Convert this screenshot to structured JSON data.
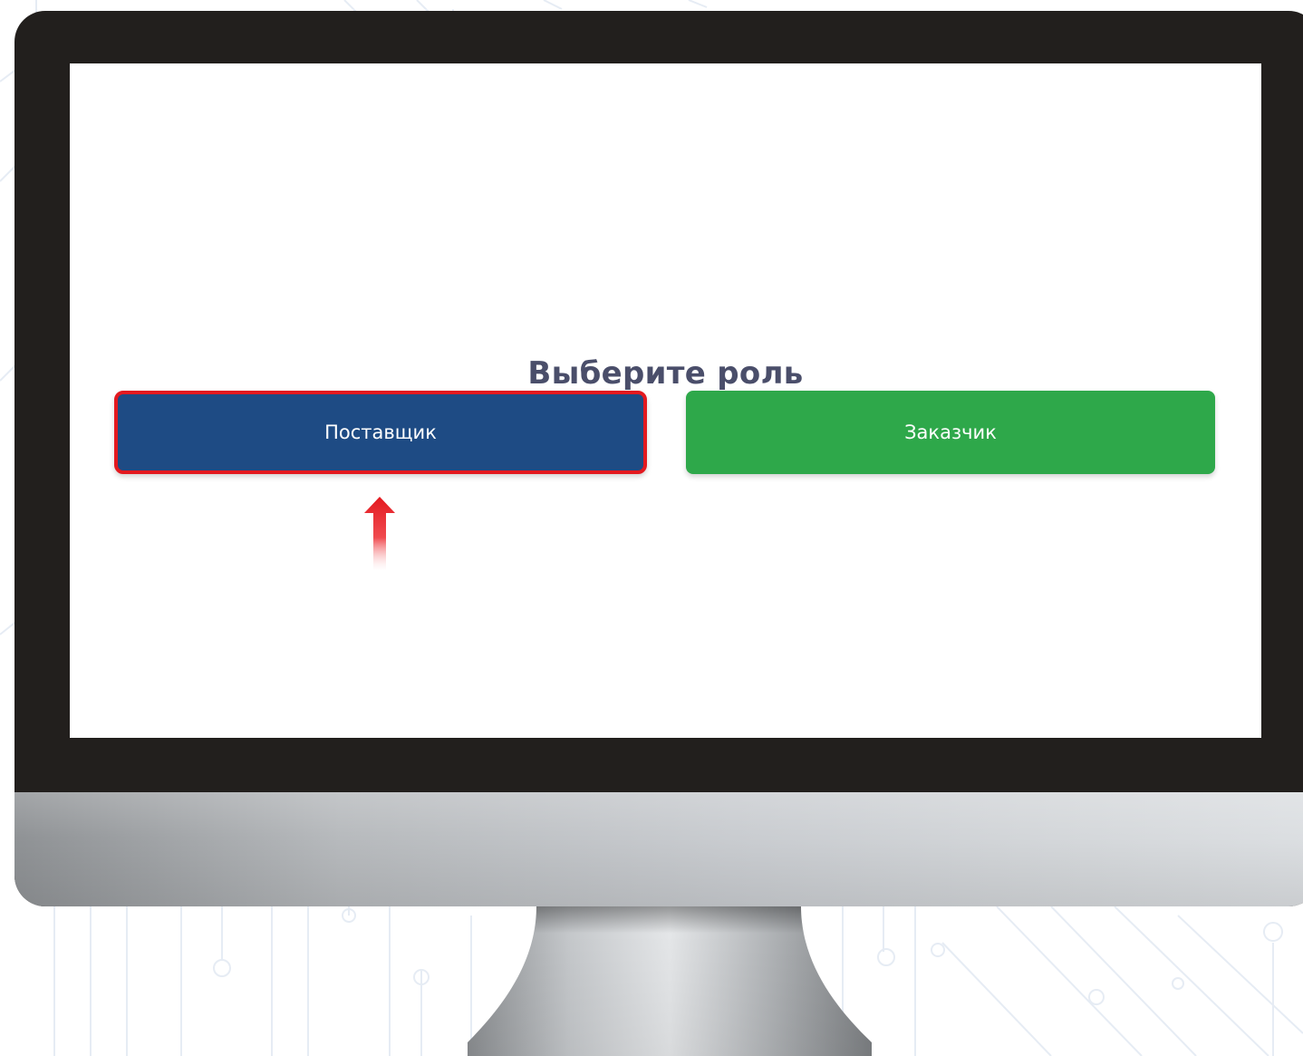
{
  "screen": {
    "title": "Выберите роль",
    "buttons": {
      "supplier_label": "Поставщик",
      "customer_label": "Заказчик"
    }
  },
  "colors": {
    "supplier_button": "#1e4b84",
    "customer_button": "#2ea84a",
    "highlight_border": "#e3191f",
    "title_text": "#4a4e6a",
    "bezel": "#221f1d"
  },
  "annotations": {
    "pointer": "red-arrow-up-icon"
  }
}
